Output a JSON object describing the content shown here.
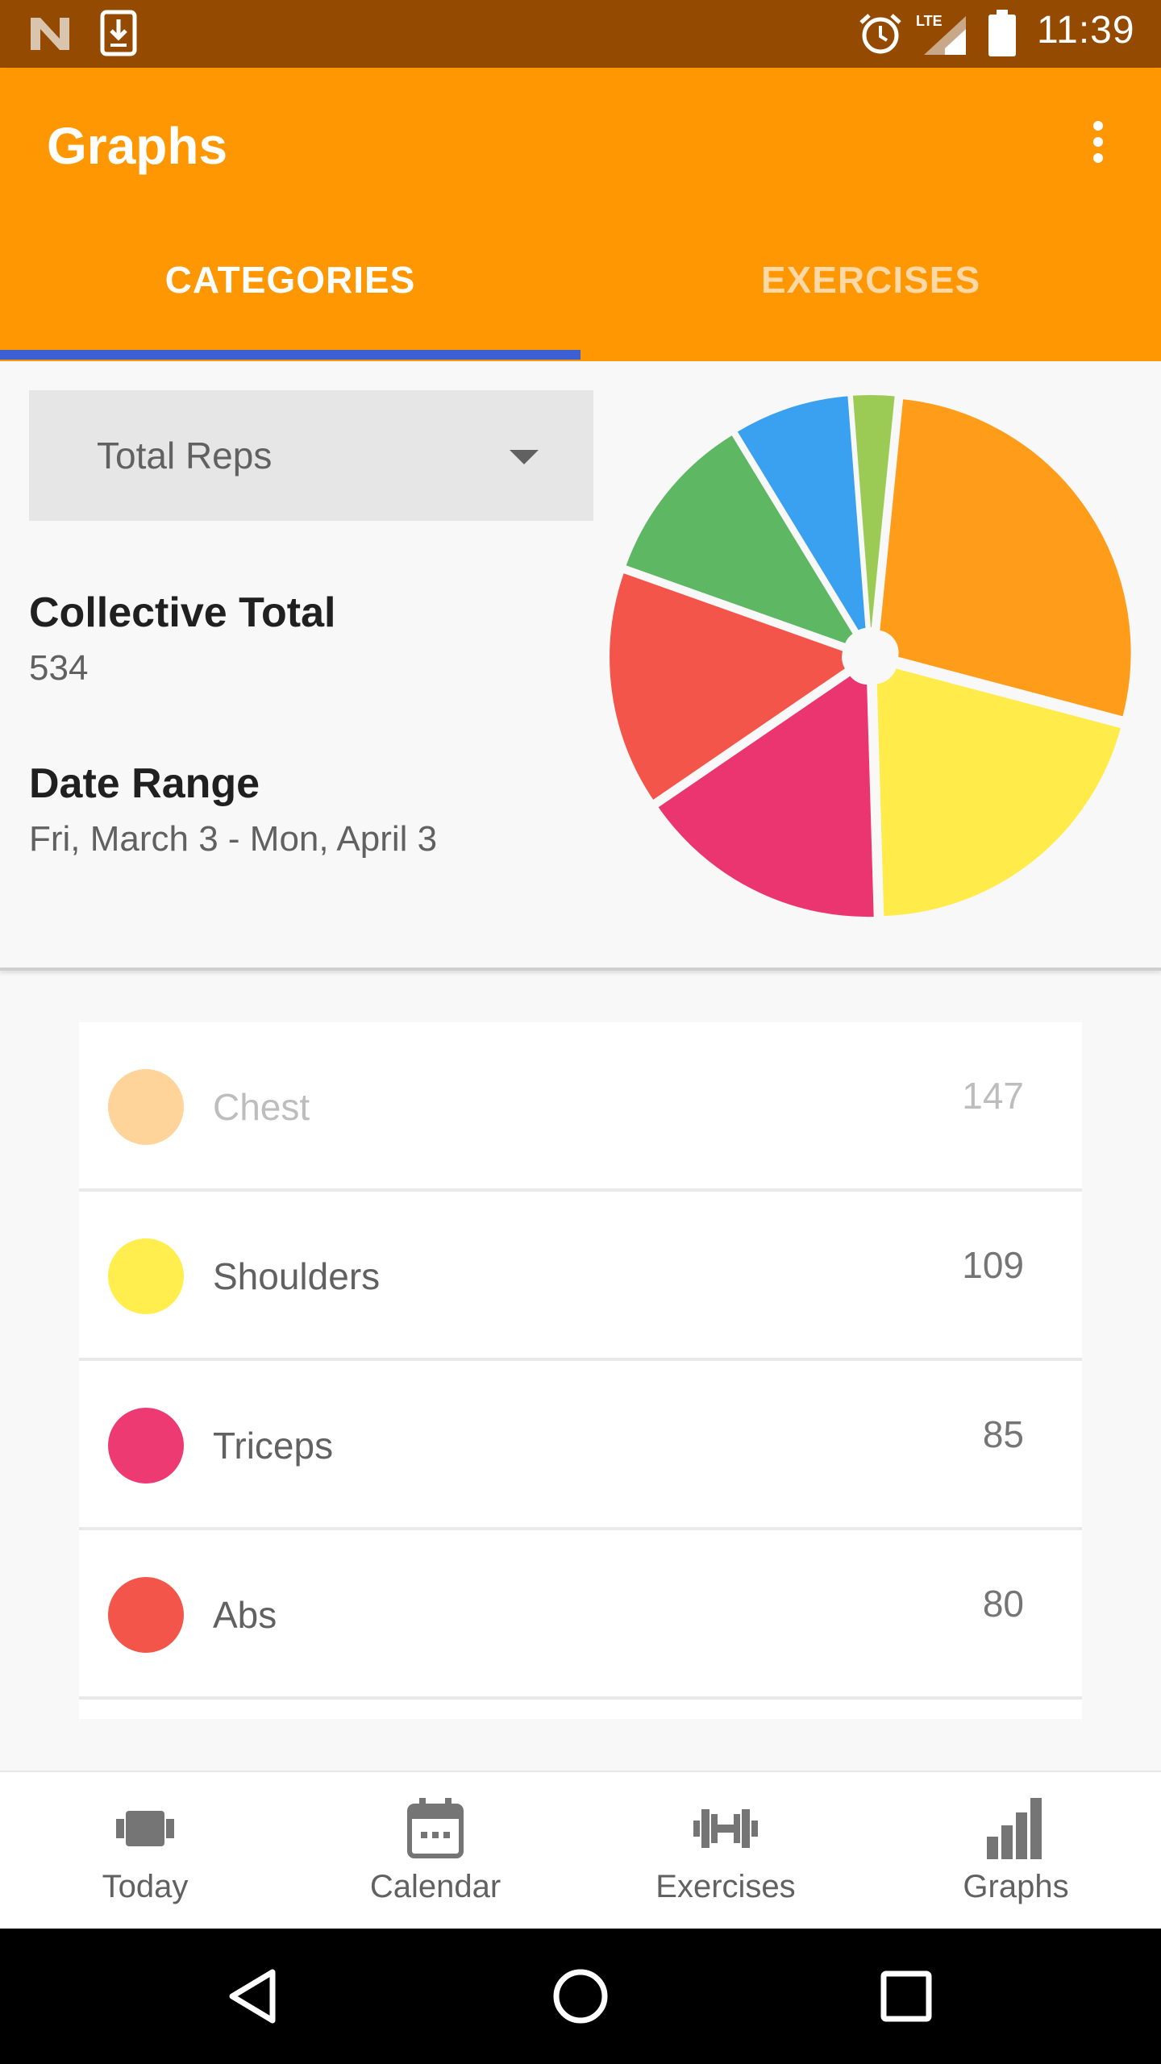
{
  "status_bar": {
    "time": "11:39",
    "network": "LTE"
  },
  "app_bar": {
    "title": "Graphs"
  },
  "tabs": [
    {
      "label": "CATEGORIES",
      "active": true
    },
    {
      "label": "EXERCISES",
      "active": false
    }
  ],
  "summary": {
    "metric_selector": "Total Reps",
    "collective_total_label": "Collective Total",
    "collective_total_value": "534",
    "date_range_label": "Date Range",
    "date_range_value": "Fri, March 3 - Mon, April 3"
  },
  "chart_data": {
    "type": "pie",
    "title": "",
    "slices": [
      {
        "label": "Chest",
        "value": 147,
        "color": "#ff9c1a"
      },
      {
        "label": "Shoulders",
        "value": 109,
        "color": "#ffeb4a"
      },
      {
        "label": "Triceps",
        "value": 85,
        "color": "#ea3570"
      },
      {
        "label": "Abs",
        "value": 80,
        "color": "#f4554a"
      },
      {
        "label": "",
        "value": 58,
        "color": "#5eb763"
      },
      {
        "label": "",
        "value": 40,
        "color": "#3aa0f0"
      },
      {
        "label": "",
        "value": 15,
        "color": "#9ccb55"
      }
    ]
  },
  "list": {
    "items": [
      {
        "label": "Chest",
        "value": "147",
        "color": "#ffd49a",
        "faded": true
      },
      {
        "label": "Shoulders",
        "value": "109",
        "color": "#ffee4d",
        "faded": false
      },
      {
        "label": "Triceps",
        "value": "85",
        "color": "#ed3a73",
        "faded": false
      },
      {
        "label": "Abs",
        "value": "80",
        "color": "#f4554a",
        "faded": false
      }
    ]
  },
  "bottom_nav": {
    "items": [
      {
        "label": "Today",
        "icon": "dumbbell-plate-icon"
      },
      {
        "label": "Calendar",
        "icon": "calendar-icon"
      },
      {
        "label": "Exercises",
        "icon": "barbell-icon"
      },
      {
        "label": "Graphs",
        "icon": "bar-chart-icon"
      }
    ]
  },
  "colors": {
    "status_bar": "#944a00",
    "app_bar": "#ff9702",
    "tab_indicator": "#3d5fd6"
  }
}
